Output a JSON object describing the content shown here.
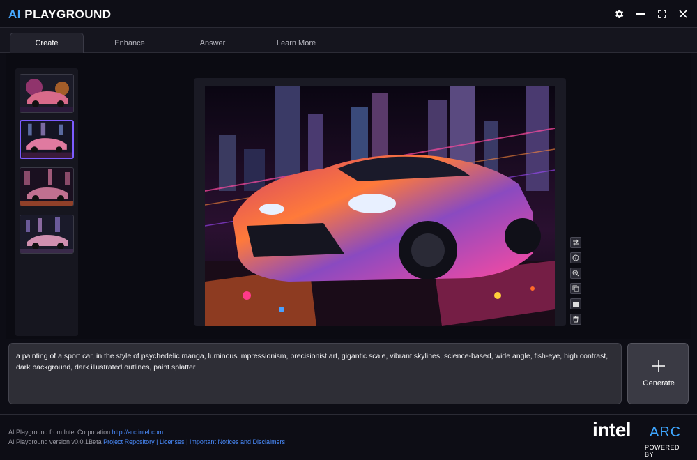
{
  "app": {
    "logo_ai": "AI",
    "logo_name": "PLAYGROUND"
  },
  "window_controls": [
    {
      "name": "settings",
      "icon": "gear-icon"
    },
    {
      "name": "minimize",
      "icon": "minimize-icon"
    },
    {
      "name": "maximize",
      "icon": "maximize-icon"
    },
    {
      "name": "close",
      "icon": "close-icon"
    }
  ],
  "tabs": [
    {
      "label": "Create",
      "active": true
    },
    {
      "label": "Enhance",
      "active": false
    },
    {
      "label": "Answer",
      "active": false
    },
    {
      "label": "Learn More",
      "active": false
    }
  ],
  "thumbnails": [
    {
      "icon": "car-thumbnail",
      "selected": false
    },
    {
      "icon": "car-thumbnail",
      "selected": true
    },
    {
      "icon": "car-thumbnail",
      "selected": false
    },
    {
      "icon": "car-thumbnail",
      "selected": false
    }
  ],
  "preview_tools": [
    {
      "icon": "compare-icon"
    },
    {
      "icon": "info-icon"
    },
    {
      "icon": "zoom-in-icon"
    },
    {
      "icon": "copy-icon"
    },
    {
      "icon": "folder-icon"
    },
    {
      "icon": "trash-icon"
    }
  ],
  "prompt": {
    "value": "a painting of a sport car, in the style of psychedelic manga, luminous impressionism, precisionist art, gigantic scale, vibrant skylines, science-based, wide angle, fish-eye, high contrast, dark background, dark illustrated outlines, paint splatter"
  },
  "generate": {
    "label": "Generate"
  },
  "footer": {
    "line1_text": "AI Playground from Intel Corporation",
    "line1_link": "http://arc.intel.com",
    "line2_text": "AI Playground version v0.0.1Beta",
    "link_repo": "Project Repository",
    "sep1": "|",
    "link_licenses": "Licenses",
    "sep2": "|",
    "link_notices": "Important Notices and Disclaimers"
  },
  "branding": {
    "intel": "intel",
    "arc": "ARC",
    "powered_by": "POWERED BY"
  },
  "colors": {
    "accent_blue": "#47a8ff",
    "selected_border": "#7d5cff",
    "link": "#4a8dff"
  }
}
